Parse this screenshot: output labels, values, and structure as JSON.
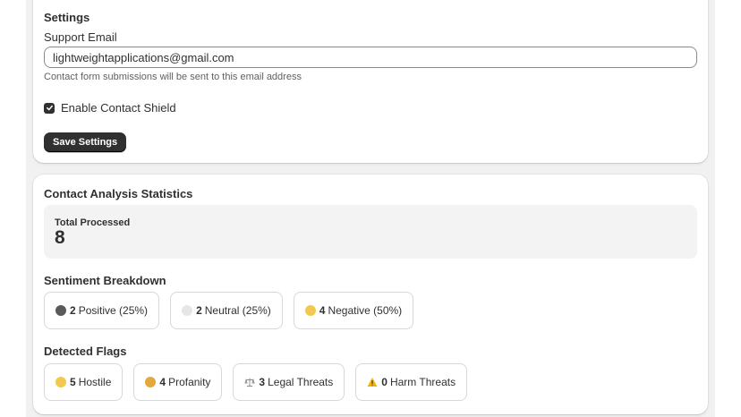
{
  "settings": {
    "title": "Settings",
    "email_label": "Support Email",
    "email_value": "lightweightapplications@gmail.com",
    "email_help": "Contact form submissions will be sent to this email address",
    "shield_label": "Enable Contact Shield",
    "shield_enabled": true,
    "save_label": "Save Settings"
  },
  "stats": {
    "title": "Contact Analysis Statistics",
    "total_label": "Total Processed",
    "total_value": "8",
    "sentiment_title": "Sentiment Breakdown",
    "sentiment": [
      {
        "icon": "positive-face-icon",
        "count": "2",
        "label": "Positive (25%)",
        "color": "#5a5a5a"
      },
      {
        "icon": "neutral-face-icon",
        "count": "2",
        "label": "Neutral (25%)",
        "color": "#e6e6e6"
      },
      {
        "icon": "negative-face-icon",
        "count": "4",
        "label": "Negative (50%)",
        "color": "#f2c94c"
      }
    ],
    "flags_title": "Detected Flags",
    "flags": [
      {
        "icon": "hostile-face-icon",
        "count": "5",
        "label": "Hostile",
        "color": "#f2c94c"
      },
      {
        "icon": "profanity-face-icon",
        "count": "4",
        "label": "Profanity",
        "color": "#e0a93a"
      },
      {
        "icon": "scales-icon",
        "count": "3",
        "label": "Legal Threats",
        "color": "#9a9a9a"
      },
      {
        "icon": "warning-icon",
        "count": "0",
        "label": "Harm Threats",
        "color": "#f4b400"
      }
    ]
  },
  "colors": {
    "primary_button": "#303030",
    "background": "#f1f1f1",
    "card": "#ffffff"
  }
}
